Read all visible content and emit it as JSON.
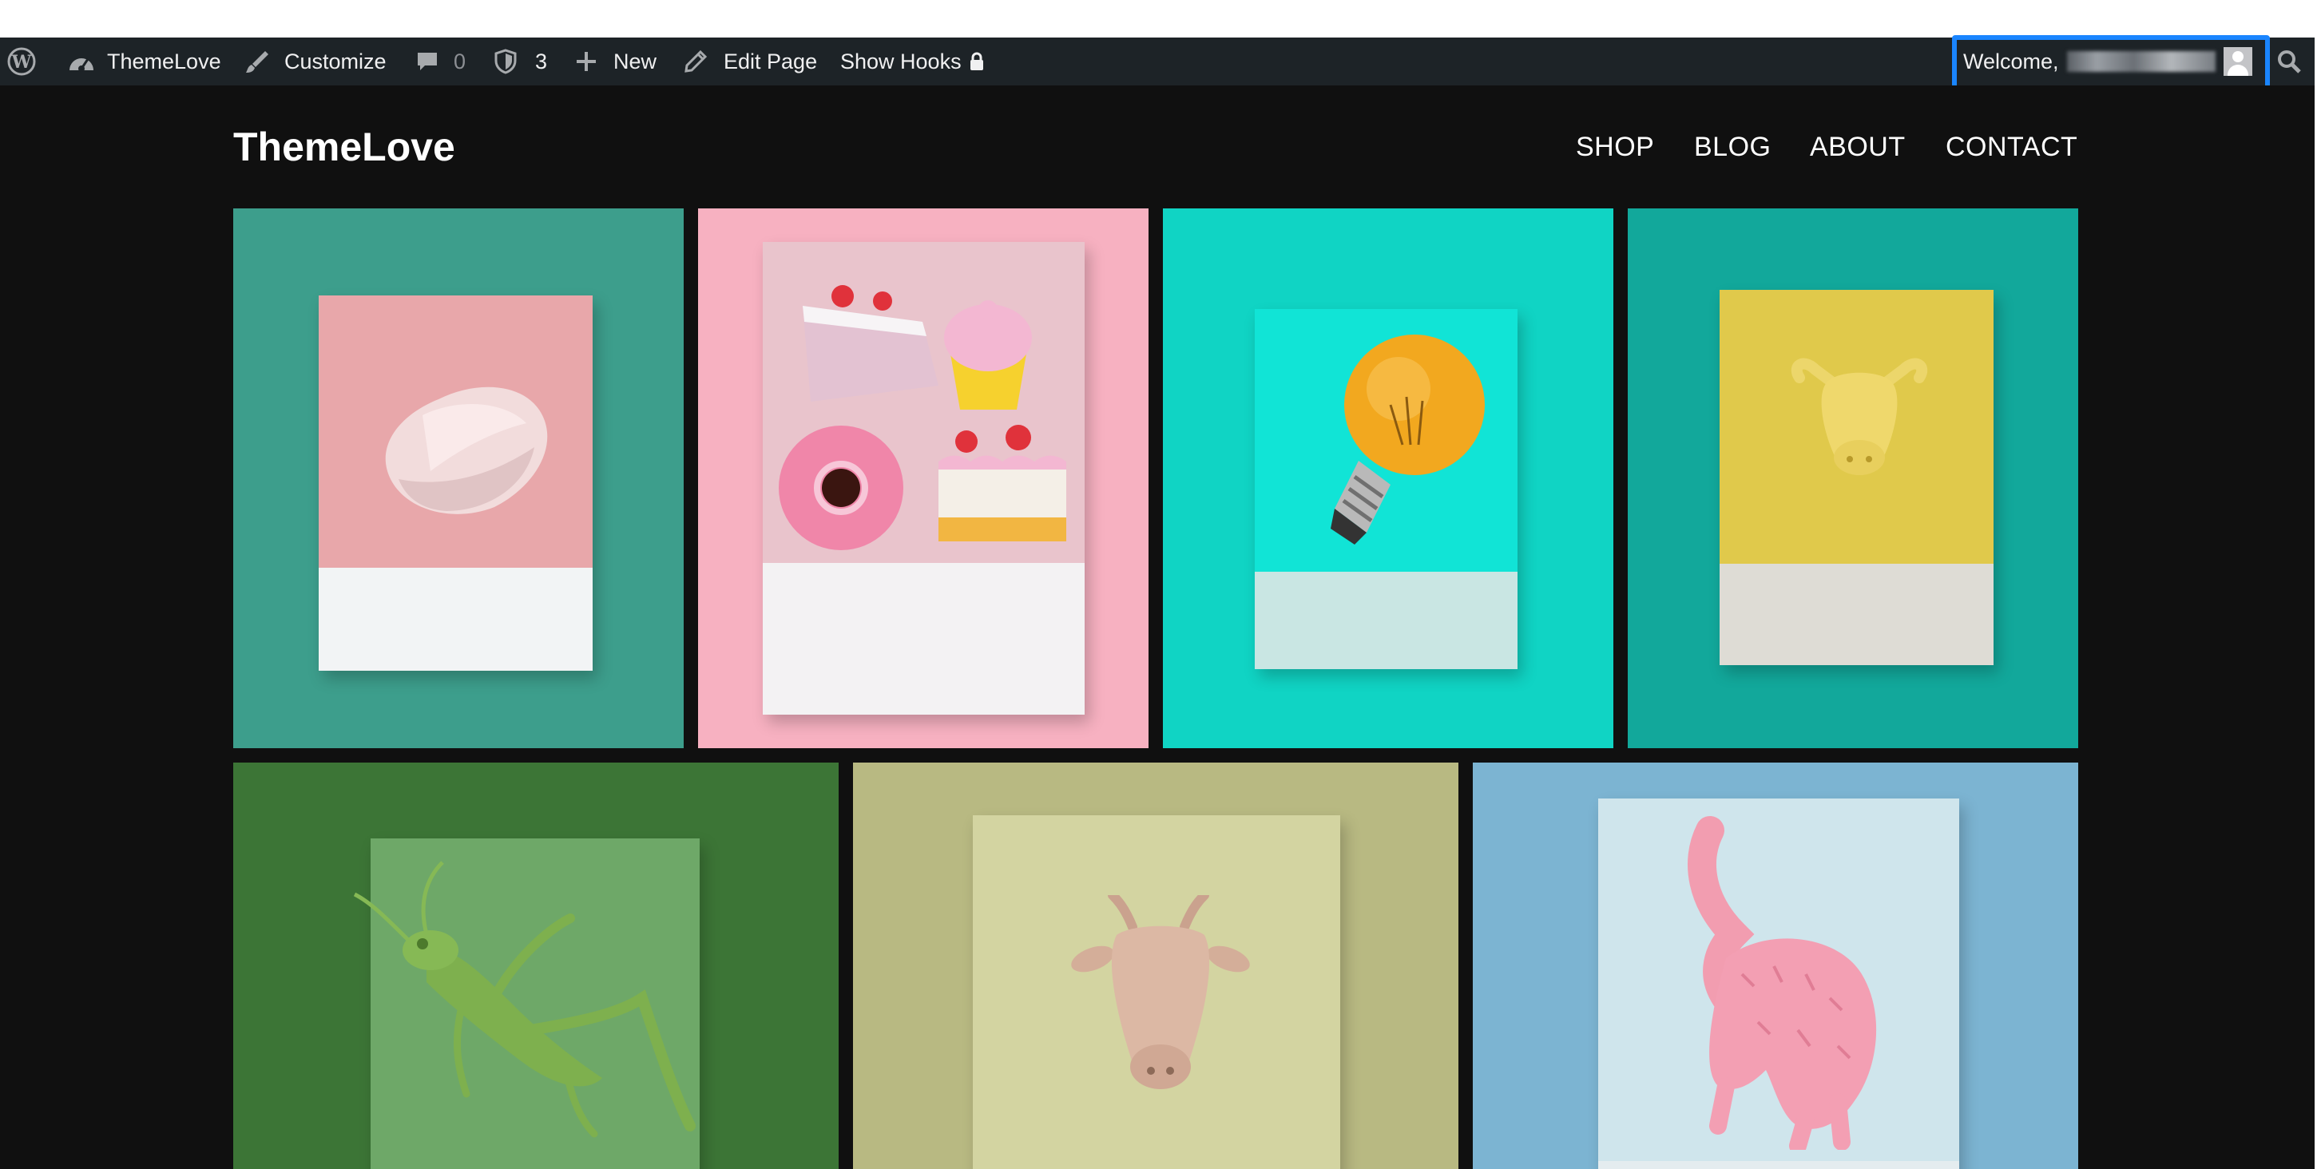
{
  "admin_bar": {
    "site_name": "ThemeLove",
    "customize": "Customize",
    "comments_count": "0",
    "updates_count": "3",
    "new_label": "New",
    "edit_page": "Edit Page",
    "show_hooks": "Show Hooks",
    "welcome": "Welcome,",
    "icons": [
      "wordpress-logo-icon",
      "dashboard-icon",
      "brush-icon",
      "comment-icon",
      "shield-icon",
      "plus-icon",
      "pencil-icon",
      "lock-icon",
      "avatar",
      "search-icon"
    ]
  },
  "site": {
    "title": "ThemeLove",
    "nav": [
      "SHOP",
      "BLOG",
      "ABOUT",
      "CONTACT"
    ]
  },
  "gallery": {
    "row1": [
      {
        "subject": "rose quartz crystal",
        "background": "#3d9e8c",
        "card_top": "#e8a7aa",
        "card_bottom": "#f2f4f5"
      },
      {
        "subject": "toy cake and cupcake desserts",
        "background": "#f7b1c1",
        "card_top": "#e9c4cc",
        "card_bottom": "#f3f2f3"
      },
      {
        "subject": "orange light bulb",
        "background": "#10d4c4",
        "card_top": "#11e4d6",
        "card_bottom": "#c9e6e3"
      },
      {
        "subject": "yellow bull head figurine",
        "background": "#12a89b",
        "card_top": "#e0c94b",
        "card_bottom": "#dedcd5"
      }
    ],
    "row2": [
      {
        "subject": "green grasshopper toy",
        "background": "#3c7536",
        "card_top": "#6ea868",
        "card_bottom": "#d8dcd7"
      },
      {
        "subject": "goat head figurine",
        "background": "#b8b982",
        "card_top": "#d3d4a1",
        "card_bottom": "#e2e2cf"
      },
      {
        "subject": "pink furry animal toy",
        "background": "#7cb4d2",
        "card_top": "#cfe5ec",
        "card_bottom": "#e4ecef"
      }
    ]
  },
  "colors": {
    "admin_bar_bg": "#1d2327",
    "site_bg": "#101010",
    "highlight": "#1a85ff"
  }
}
